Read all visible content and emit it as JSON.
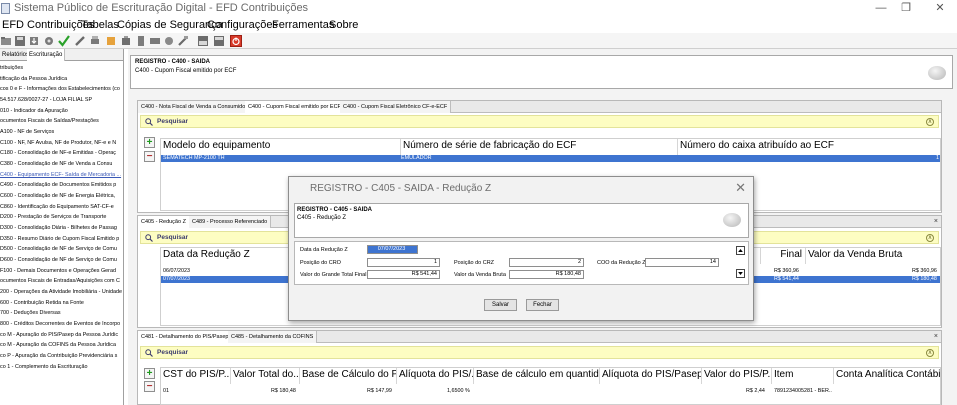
{
  "window": {
    "title": "Sistema Público de Escrituração Digital - EFD Contribuições"
  },
  "menu": {
    "items": [
      "EFD Contribuições",
      "Tabelas",
      "Cópias de Segurança",
      "Configurações",
      "Ferramentas",
      "Sobre"
    ]
  },
  "toolbar": {
    "icons": [
      "open-folder-icon",
      "save-icon",
      "import-icon",
      "export-icon",
      "validate-check-icon",
      "sign-pen-icon",
      "print-icon",
      "close-file-icon",
      "print-preview-icon",
      "receipt-icon",
      "transmit-icon",
      "report-icon",
      "trash-icon",
      "backup-icon",
      "restore-icon",
      "exit-icon"
    ],
    "accent_exit": "#d83a2a"
  },
  "left_panel": {
    "tabs": [
      "Relatórios",
      "Escrituração"
    ],
    "tree": [
      "tribuições",
      "tificação da Pessoa Jurídica",
      "cos 0 e F - Informações dos Estabelecimentos (co",
      "54.517.628/0027-27 - LOJA FILIAL SP",
      "010 - Indicador da Apuração",
      "ocumentos Fiscais de Saídas/Prestações",
      "A100 - NF de Serviços",
      "C100 - NF, NF Avulsa, NF de Produtor, NF-e e N",
      "C180 - Consolidação de NF-e Emitidas - Operaç",
      "C380 - Consolidação de NF de Venda a Consu",
      "C400 - Equipamento ECF- Saída de Mercadoria ...",
      "C490 - Consolidação de Documentos Emitidos p",
      "C600 - Consolidação de NF de Energia Elétrica,",
      "C860 - Identificação do Equipamento SAT-CF-e",
      "D200 - Prestação de Serviços de Transporte",
      "D300 - Consolidação Diária - Bilhetes de Passag",
      "D350 - Resumo Diário de Cupom Fiscal Emitido p",
      "D500 - Consolidação de NF de Serviço de Comu",
      "D600 - Consolidação de NF de Serviço de Comu",
      "F100 - Demais Documentos e Operações Gerad",
      "ocumentos Fiscais de Entradas/Aquisições com C",
      "200 - Operações da Atividade Imobiliária - Unidade",
      "600 - Contribuição Retida na Fonte",
      "700 - Deduções Diversas",
      "800 - Créditos Decorrentes de Eventos de Incorpo",
      "co M - Apuração do PIS/Pasep da Pessoa Jurídic",
      "co M - Apuração da COFINS da Pessoa Jurídica",
      "co P - Apuração da Contribuição Previdenciária s",
      "co 1 - Complemento da Escrituração"
    ],
    "selected_index": 10
  },
  "registro_c400": {
    "title": "REGISTRO - C400 - SAIDA",
    "subtitle": "C400 - Cupom Fiscal emitido por ECF"
  },
  "panel_c400": {
    "tabs": [
      "C400 - Nota Fiscal de Venda a Consumidor",
      "C400 - Cupom Fiscal emitido por ECF",
      "C400 - Cupom Fiscal Eletrônico CF-e-ECF"
    ],
    "search_label": "Pesquisar",
    "columns": [
      "Modelo do equipamento",
      "Número de série de fabricação do ECF",
      "Número do caixa atribuído ao ECF"
    ],
    "row": [
      "SEMATECH MP-2100 TH",
      "EMULADOR",
      "1"
    ]
  },
  "panel_c405": {
    "tabs": [
      "C405 - Redução Z",
      "C489 - Processo Referenciado"
    ],
    "close_label": "×",
    "search_label": "Pesquisar",
    "columns": [
      "Data da Redução Z",
      "Final",
      "Valor da Venda Bruta"
    ],
    "rows": [
      {
        "date": "06/07/2023",
        "final": "R$ 360,96",
        "bruta": "R$ 360,96"
      },
      {
        "date": "07/07/2023",
        "final": "R$ 541,44",
        "bruta": "R$ 180,48"
      }
    ]
  },
  "panel_c481": {
    "tabs": [
      "C481 - Detalhamento do PIS/Pasep",
      "C485 - Detalhamento da COFINS"
    ],
    "close_label": "×",
    "search_label": "Pesquisar",
    "columns": [
      "CST do PIS/P...",
      "Valor Total do...",
      "Base de Cálculo do PI...",
      "Alíquota do PIS/...",
      "Base de cálculo em quantida...",
      "Alíquota do PIS/Pasep ...",
      "Valor do PIS/P...",
      "Item",
      "Conta Analítica Contábil"
    ],
    "row": [
      "01",
      "R$ 180,48",
      "R$ 147,99",
      "1,6500 %",
      "",
      "",
      "R$ 2,44",
      "7891234005281 - BER...",
      ""
    ]
  },
  "modal": {
    "title": "REGISTRO - C405 - SAIDA - Redução Z",
    "header_title": "REGISTRO - C405 - SAIDA",
    "header_subtitle": "C405 - Redução Z",
    "fields": {
      "data_label": "Data da Redução Z",
      "data_value": "07/07/2023",
      "cro_label": "Posição do CRO",
      "cro_value": "1",
      "crz_label": "Posição do CRZ",
      "crz_value": "2",
      "coo_label": "COO da Redução Z",
      "coo_value": "14",
      "gt_label": "Valor do Grande Total Final",
      "gt_value": "R$ 541,44",
      "vb_label": "Valor da Venda Bruta",
      "vb_value": "R$ 180,48"
    },
    "save_label": "Salvar",
    "close_label": "Fechar"
  },
  "colors": {
    "selection": "#3e74d0",
    "search_bar": "#fdfdc2",
    "link": "#3a58b6"
  }
}
